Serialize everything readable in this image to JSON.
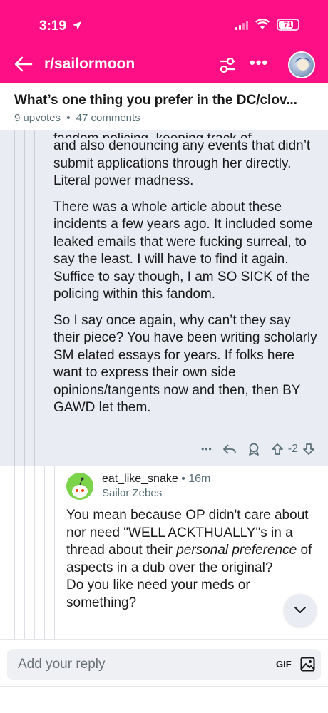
{
  "status": {
    "time": "3:19",
    "battery": "71"
  },
  "nav": {
    "subreddit": "r/sailormoon"
  },
  "post": {
    "title": "What’s one thing you prefer in the DC/clov...",
    "upvotes": "9 upvotes",
    "separator": "•",
    "comments": "47 comments"
  },
  "highlighted_comment": {
    "partial_line": "fandom policing, keeping track of",
    "paragraphs": [
      "and also denouncing any events that didn’t submit applications through her directly. Literal power madness.",
      "There was a whole article about these incidents a few years ago. It included some leaked emails that were fucking surreal, to say the least. I will have to find it again. Suffice to say though, I am SO SICK of the policing within this fandom.",
      "So I say once again, why can’t they say their piece? You have been writing scholarly SM elated essays for years. If folks here want to express their own side opinions/tangents now and then, then BY GAWD let them."
    ],
    "actions": {
      "more": "•••",
      "score": "-2"
    }
  },
  "reply": {
    "username": "eat_like_snake",
    "separator": " • ",
    "time": "16m",
    "flair": "Sailor Zebes",
    "text_before": "You mean because OP didn't care about nor need \"WELL ACKTHUALLY\"s in a thread about their ",
    "text_emphasis": "personal preference",
    "text_after": " of aspects in a dub over the original?",
    "text_line2": "Do you like need your meds or something?"
  },
  "reply_bar": {
    "placeholder": "Add your reply",
    "gif_label": "GIF"
  },
  "colors": {
    "brand": "#ff0f85",
    "highlight_bg": "#e9ecf3",
    "meta": "#576f76"
  },
  "icons": [
    "back-arrow-icon",
    "filter-icon",
    "more-icon",
    "reply-icon",
    "award-icon",
    "upvote-icon",
    "downvote-icon",
    "chevron-down-icon",
    "image-icon"
  ]
}
